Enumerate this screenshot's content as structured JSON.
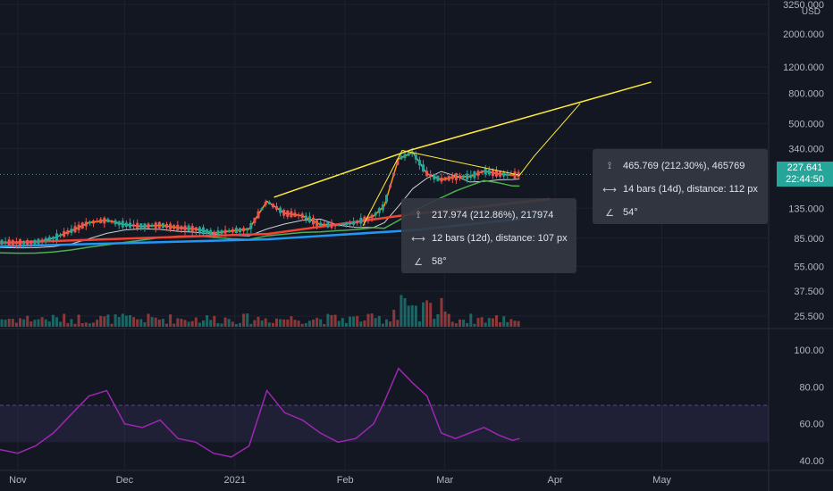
{
  "currency": "USD",
  "price_tag": {
    "price": "227.641",
    "countdown": "22:44:50",
    "color": "#26a69a"
  },
  "colors": {
    "background": "#131722",
    "up": "#26a69a",
    "down": "#ef5350",
    "trend": "#ffeb3b",
    "rsi": "#9c27b0",
    "rsi_band": "#7e57c2",
    "ema_orange": "#ff9800",
    "ema_white": "#ffffff",
    "ma_green": "#4caf50",
    "ma_red": "#f44336",
    "ma_blue": "#2196f3"
  },
  "tooltips": [
    {
      "price_change": "217.974 (212.86%), 217974",
      "bars": "12 bars (12d), distance: 107 px",
      "angle": "58°"
    },
    {
      "price_change": "465.769 (212.30%), 465769",
      "bars": "14 bars (14d), distance: 112 px",
      "angle": "54°"
    }
  ],
  "chart_data": [
    {
      "type": "line",
      "scale": "log",
      "y_tick_labels": [
        "3250.000",
        "2000.000",
        "1200.000",
        "800.000",
        "500.000",
        "340.000",
        "135.000",
        "85.000",
        "55.000",
        "37.500",
        "25.500"
      ],
      "y_ticks": [
        3250,
        2000,
        1200,
        800,
        500,
        340,
        135,
        85,
        55,
        37.5,
        25.5
      ],
      "x_tick_labels": [
        "Nov",
        "Dec",
        "2021",
        "Feb",
        "Mar",
        "Apr",
        "May"
      ],
      "x_ticks": [
        "2020-11-01",
        "2020-12-01",
        "2021-01-01",
        "2021-02-01",
        "2021-03-01",
        "2021-04-01",
        "2021-05-01"
      ],
      "series": [
        {
          "x": [
            "2020-10-27",
            "2020-11-01",
            "2020-11-06",
            "2020-11-11",
            "2020-11-16",
            "2020-11-21",
            "2020-11-26",
            "2020-12-01",
            "2020-12-06",
            "2020-12-11",
            "2020-12-16",
            "2020-12-21",
            "2020-12-26",
            "2020-12-31",
            "2021-01-05",
            "2021-01-10",
            "2021-01-15",
            "2021-01-20",
            "2021-01-25",
            "2021-01-30",
            "2021-02-04",
            "2021-02-09",
            "2021-02-12",
            "2021-02-16",
            "2021-02-20",
            "2021-02-24",
            "2021-02-28",
            "2021-03-04",
            "2021-03-08",
            "2021-03-12",
            "2021-03-16",
            "2021-03-20",
            "2021-03-22"
          ],
          "values": [
            80,
            79,
            80,
            85,
            95,
            108,
            112,
            105,
            102,
            104,
            100,
            98,
            92,
            95,
            98,
            150,
            125,
            120,
            105,
            104,
            108,
            120,
            140,
            290,
            320,
            230,
            210,
            220,
            220,
            240,
            230,
            225,
            227.6
          ]
        }
      ],
      "trend_lines": [
        {
          "x": [
            "2021-01-12",
            "2021-02-19"
          ],
          "values": [
            160,
            330
          ]
        },
        {
          "x": [
            "2021-02-19",
            "2021-04-28"
          ],
          "values": [
            330,
            950
          ]
        }
      ],
      "projections": [
        {
          "x": [
            "2021-02-06",
            "2021-02-17",
            "2021-03-22"
          ],
          "values": [
            103,
            330,
            225
          ]
        },
        {
          "x": [
            "2021-03-22",
            "2021-03-26",
            "2021-04-08"
          ],
          "values": [
            225,
            300,
            680
          ]
        }
      ]
    },
    {
      "type": "line",
      "y_tick_labels": [
        "100.00",
        "80.00",
        "60.00",
        "40.00"
      ],
      "y_ticks": [
        100,
        80,
        60,
        40
      ],
      "band": [
        50,
        70
      ],
      "series": [
        {
          "x": [
            "2020-10-27",
            "2020-11-01",
            "2020-11-06",
            "2020-11-11",
            "2020-11-16",
            "2020-11-21",
            "2020-11-26",
            "2020-12-01",
            "2020-12-06",
            "2020-12-11",
            "2020-12-16",
            "2020-12-21",
            "2020-12-26",
            "2020-12-31",
            "2021-01-05",
            "2021-01-10",
            "2021-01-15",
            "2021-01-20",
            "2021-01-25",
            "2021-01-30",
            "2021-02-04",
            "2021-02-09",
            "2021-02-12",
            "2021-02-16",
            "2021-02-20",
            "2021-02-24",
            "2021-02-28",
            "2021-03-04",
            "2021-03-08",
            "2021-03-12",
            "2021-03-16",
            "2021-03-20",
            "2021-03-22"
          ],
          "values": [
            46,
            44,
            48,
            55,
            65,
            75,
            78,
            60,
            58,
            62,
            52,
            50,
            44,
            42,
            48,
            78,
            66,
            62,
            55,
            50,
            52,
            60,
            72,
            90,
            82,
            75,
            55,
            52,
            55,
            58,
            54,
            51,
            52
          ]
        }
      ]
    }
  ]
}
